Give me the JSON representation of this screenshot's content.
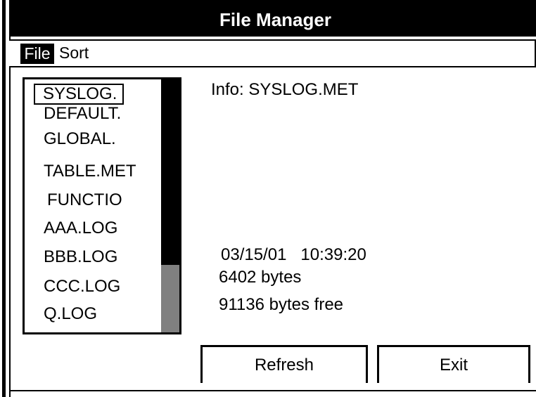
{
  "window": {
    "title": "File Manager"
  },
  "menu": {
    "file": "File",
    "sort": "Sort"
  },
  "files": [
    "SYSLOG.",
    "DEFAULT.",
    "GLOBAL.",
    "TABLE.MET",
    "FUNCTIO",
    "AAA.LOG",
    "BBB.LOG",
    "CCC.LOG",
    "Q.LOG"
  ],
  "selected_file_index": 0,
  "info": {
    "label": "Info: SYSLOG.MET",
    "datetime": "03/15/01   10:39:20",
    "size": "6402 bytes",
    "free": "91136 bytes free"
  },
  "buttons": {
    "refresh": "Refresh",
    "exit": "Exit"
  },
  "colors": {
    "bar": "#000000",
    "background": "#ffffff",
    "scroll_thumb": "#808080"
  }
}
